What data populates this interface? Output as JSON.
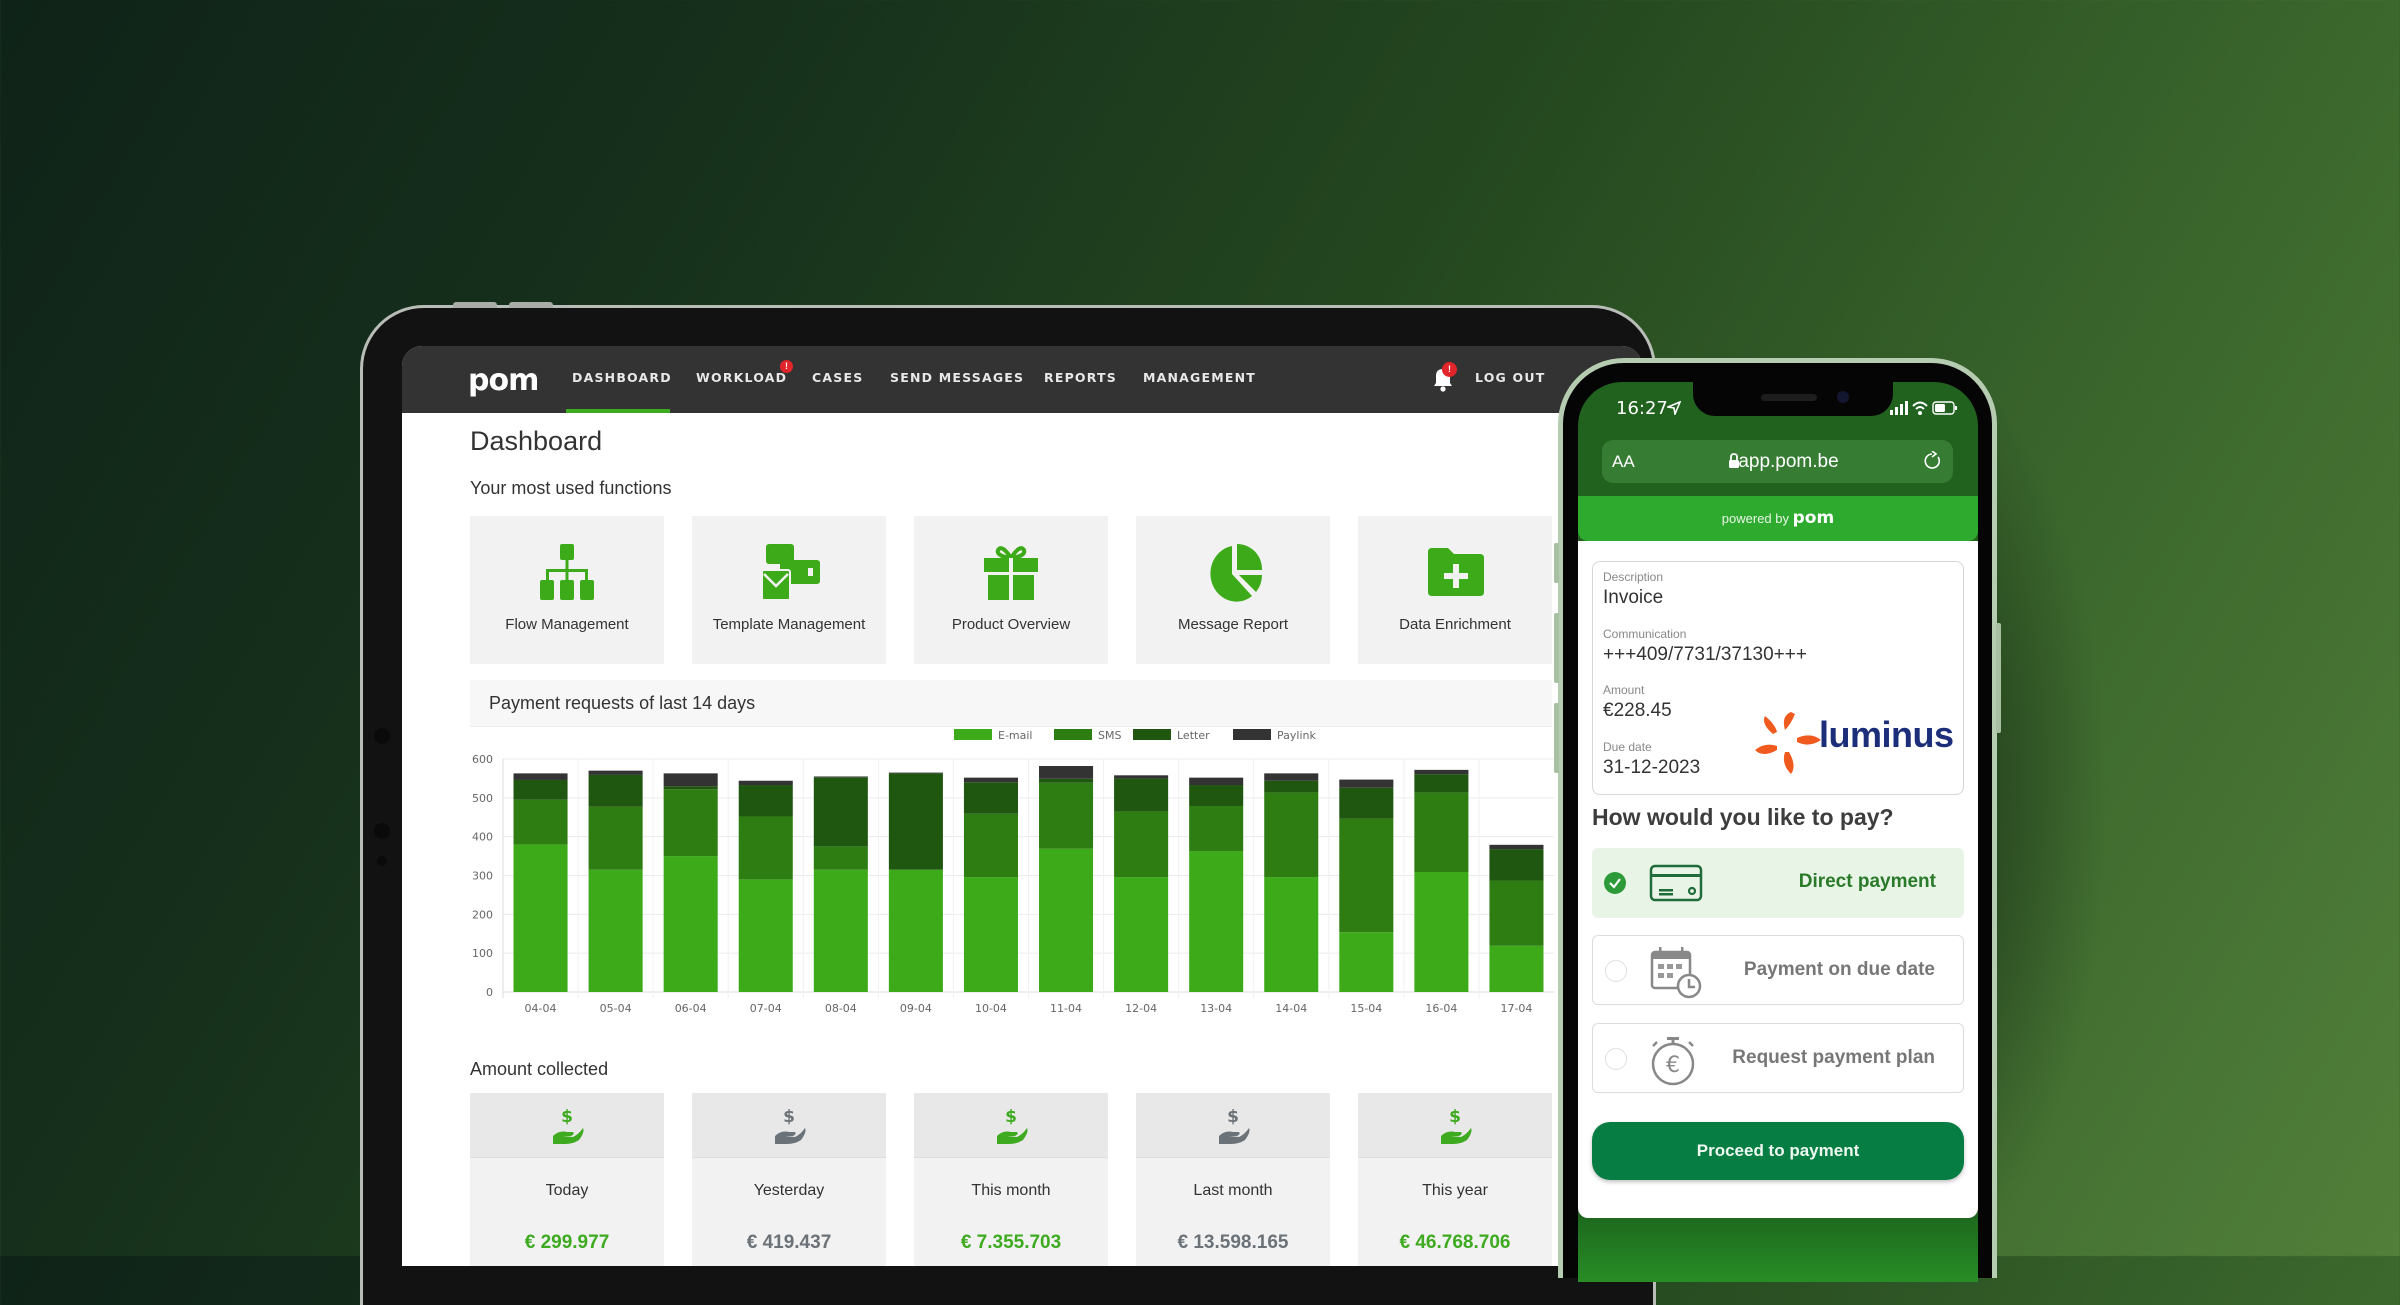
{
  "colors": {
    "accent": "#3daa1f",
    "email": "#3daa1a",
    "sms": "#2d7d13",
    "letter": "#1f5610",
    "paylink": "#333333",
    "amount_green": "#3daa1f",
    "amount_gray": "#6b7278",
    "phone_primary": "#067e43"
  },
  "tablet": {
    "nav": {
      "logo": "pom",
      "items": [
        {
          "label": "DASHBOARD",
          "active": true
        },
        {
          "label": "WORKLOAD",
          "badge": "!"
        },
        {
          "label": "CASES"
        },
        {
          "label": "SEND MESSAGES"
        },
        {
          "label": "REPORTS"
        },
        {
          "label": "MANAGEMENT"
        }
      ],
      "notification_badge": "!",
      "logout": "LOG OUT"
    },
    "page_title": "Dashboard",
    "functions_title": "Your most used functions",
    "functions": [
      {
        "label": "Flow Management",
        "icon": "sitemap-icon"
      },
      {
        "label": "Template Management",
        "icon": "template-icon"
      },
      {
        "label": "Product Overview",
        "icon": "gift-icon"
      },
      {
        "label": "Message Report",
        "icon": "pie-chart-icon"
      },
      {
        "label": "Data Enrichment",
        "icon": "folder-plus-icon"
      }
    ],
    "chart_title": "Payment requests of last 14 days",
    "amount_title": "Amount collected",
    "amounts": [
      {
        "label": "Today",
        "value": "€ 299.977",
        "highlight": true
      },
      {
        "label": "Yesterday",
        "value": "€ 419.437",
        "highlight": false
      },
      {
        "label": "This month",
        "value": "€ 7.355.703",
        "highlight": true
      },
      {
        "label": "Last month",
        "value": "€ 13.598.165",
        "highlight": false
      },
      {
        "label": "This year",
        "value": "€ 46.768.706",
        "highlight": true
      }
    ]
  },
  "chart_data": {
    "type": "bar",
    "stacked": true,
    "title": "Payment requests of last 14 days",
    "xlabel": "",
    "ylabel": "",
    "ylim": [
      0,
      600
    ],
    "yticks": [
      0,
      100,
      200,
      300,
      400,
      500,
      600
    ],
    "grid": true,
    "legend_position": "top-center",
    "categories": [
      "04-04",
      "05-04",
      "06-04",
      "07-04",
      "08-04",
      "09-04",
      "10-04",
      "11-04",
      "12-04",
      "13-04",
      "14-04",
      "15-04",
      "16-04",
      "17-04"
    ],
    "series": [
      {
        "name": "E-mail",
        "values": [
          380,
          315,
          350,
          290,
          315,
          315,
          296,
          369,
          296,
          363,
          296,
          154,
          309,
          119
        ]
      },
      {
        "name": "SMS",
        "values": [
          115,
          162,
          172,
          162,
          60,
          0,
          163,
          170,
          169,
          116,
          218,
          292,
          205,
          168
        ]
      },
      {
        "name": "Letter",
        "values": [
          51,
          82,
          8,
          81,
          178,
          248,
          81,
          10,
          85,
          54,
          30,
          80,
          47,
          81
        ]
      },
      {
        "name": "Paylink",
        "values": [
          17,
          11,
          33,
          11,
          2,
          2,
          12,
          33,
          8,
          19,
          19,
          21,
          11,
          11
        ]
      }
    ]
  },
  "phone": {
    "status_time": "16:27",
    "url_aa": "AA",
    "url": "app.pom.be",
    "powered_by": "powered by",
    "powered_logo": "pom",
    "invoice": {
      "description_label": "Description",
      "description": "Invoice",
      "communication_label": "Communication",
      "communication": "+++409/7731/37130+++",
      "amount_label": "Amount",
      "amount": "€228.45",
      "due_label": "Due date",
      "due": "31-12-2023",
      "merchant": "luminus"
    },
    "question": "How would you like to pay?",
    "options": [
      {
        "label": "Direct payment",
        "selected": true,
        "icon": "credit-card-icon"
      },
      {
        "label": "Payment on due date",
        "selected": false,
        "icon": "calendar-clock-icon"
      },
      {
        "label": "Request payment plan",
        "selected": false,
        "icon": "euro-stopwatch-icon"
      }
    ],
    "proceed": "Proceed to payment"
  }
}
